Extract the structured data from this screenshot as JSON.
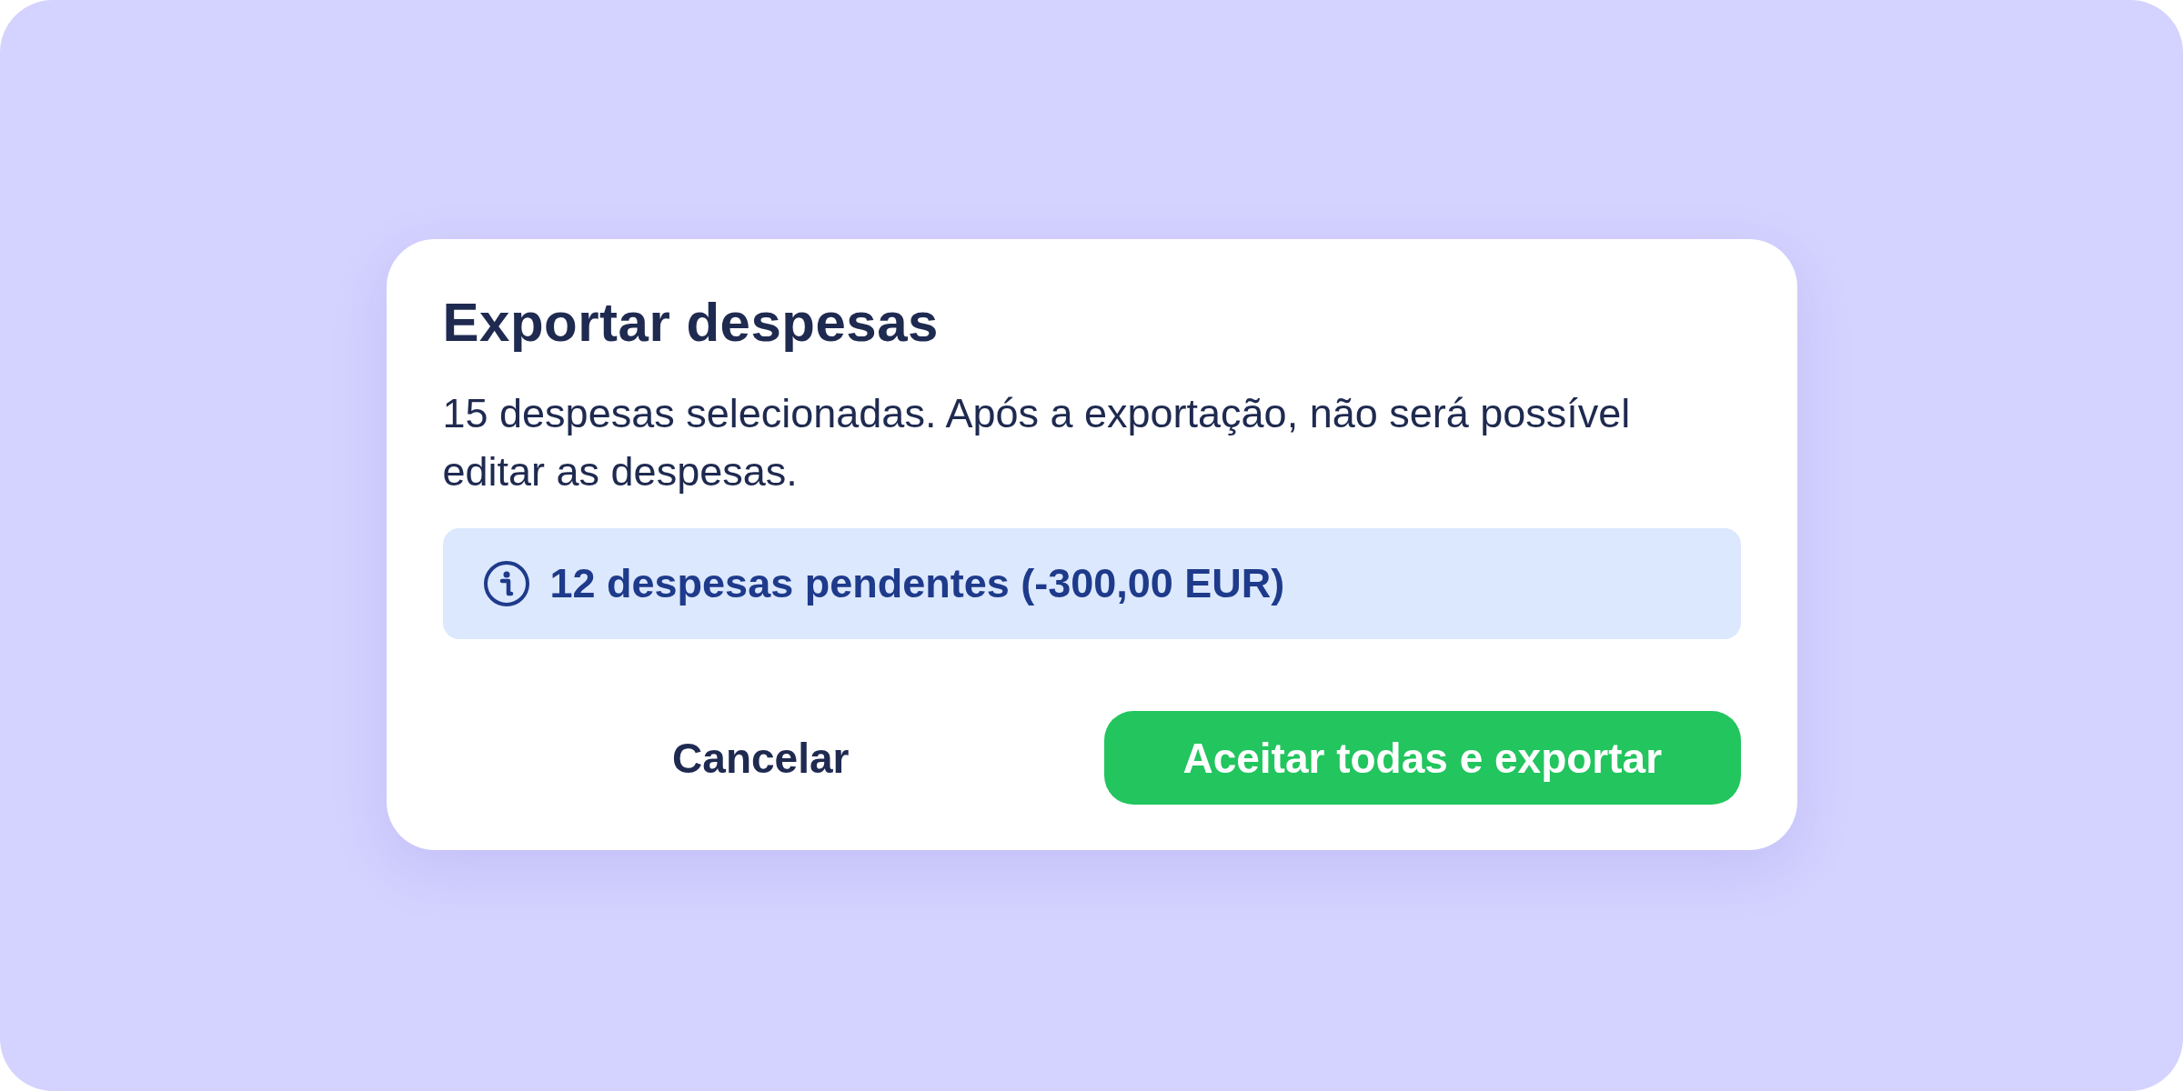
{
  "dialog": {
    "title": "Exportar despesas",
    "message": "15 despesas selecionadas. Após a exportação, não será possível editar as despesas.",
    "notice": {
      "text": "12 despesas pendentes (-300,00 EUR)"
    },
    "buttons": [
      {
        "label": "Cancelar",
        "kind": "secondary"
      },
      {
        "label": "Aceitar todas e exportar",
        "kind": "primary"
      }
    ]
  }
}
